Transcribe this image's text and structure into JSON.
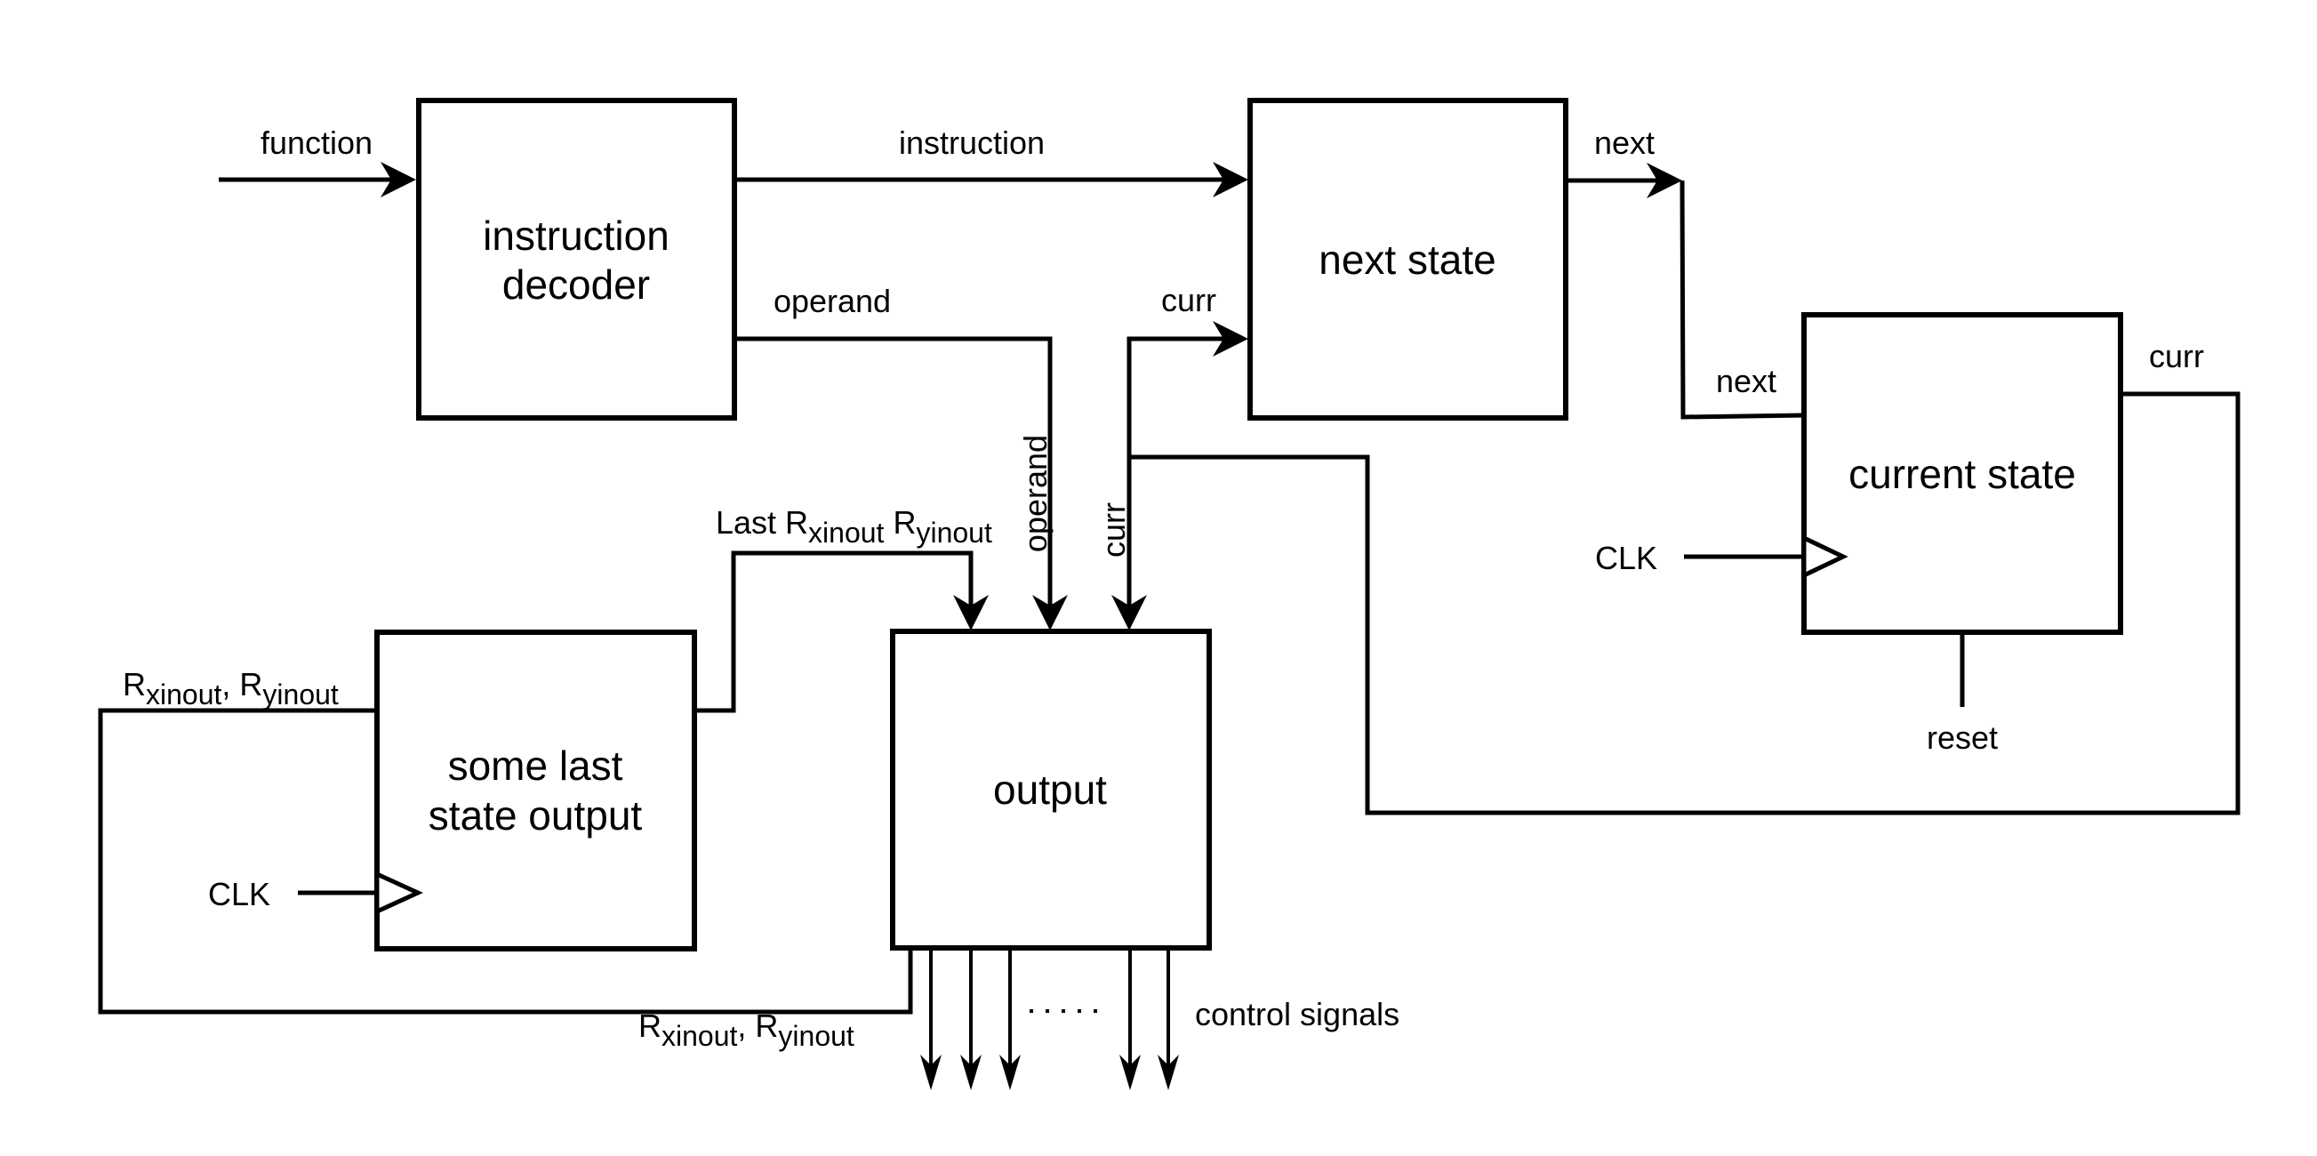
{
  "diagram": {
    "title": "",
    "blocks": {
      "instruction_decoder": {
        "label_lines": [
          "instruction",
          "decoder"
        ]
      },
      "next_state": {
        "label_lines": [
          "next state"
        ]
      },
      "current_state": {
        "label_lines": [
          "current state"
        ]
      },
      "last_state_output": {
        "label_lines": [
          "some last",
          "state output"
        ]
      },
      "output": {
        "label_lines": [
          "output"
        ]
      }
    },
    "signals": {
      "function": "function",
      "instruction": "instruction",
      "operand_horizontal": "operand",
      "operand_vertical": "operand",
      "curr_to_next_state": "curr",
      "curr_vertical": "curr",
      "next_out": "next",
      "next_in": "next",
      "curr_out": "curr",
      "reset": "reset",
      "clk_current_state": "CLK",
      "clk_last_state": "CLK",
      "last_r_prefix": "Last ",
      "r_main": "R",
      "xinout_sub": "xinout",
      "yinout_sub": "yinout",
      "separator": ", ",
      "space": " ",
      "ellipsis": "·····",
      "control_signals": "control signals"
    },
    "control_signal_count_shown": 5
  }
}
